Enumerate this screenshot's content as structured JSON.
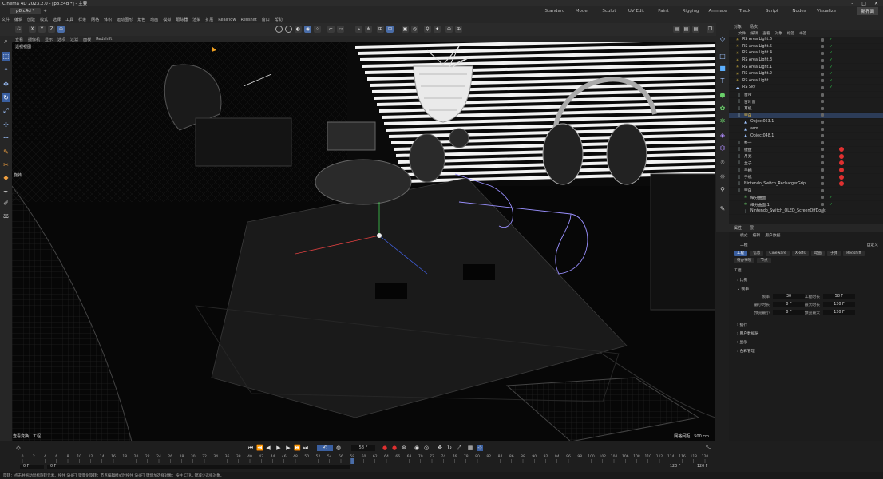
{
  "titlebar": {
    "title": "Cinema 4D 2023.2.0 - [p8.c4d *] - 主要"
  },
  "tabs": {
    "document": "p8.c4d *",
    "layouts": [
      "Standard",
      "Model",
      "Sculpt",
      "UV Edit",
      "Paint",
      "Rigging",
      "Animate",
      "Track",
      "Script",
      "Nodes",
      "Visualize"
    ],
    "new_label": "新界面"
  },
  "menubar": [
    "文件",
    "编辑",
    "创建",
    "模式",
    "选择",
    "工具",
    "样条",
    "网格",
    "体积",
    "运动图形",
    "角色",
    "动画",
    "模拟",
    "跟踪器",
    "渲染",
    "扩展",
    "RealFlow",
    "Redshift",
    "窗口",
    "帮助"
  ],
  "toolbar": {
    "x": "X",
    "y": "Y",
    "z": "Z"
  },
  "viewport_menu": [
    "查看",
    "摄像机",
    "显示",
    "选项",
    "过滤",
    "面板",
    "Redshift"
  ],
  "viewport": {
    "camera": "透视视图",
    "mode": "旋转",
    "selection_label": "查看变换：工程",
    "grid": "网格间距：500 cm"
  },
  "object_manager": {
    "tabs": [
      "对象",
      "场次"
    ],
    "menu": [
      "文件",
      "编辑",
      "查看",
      "对象",
      "标签",
      "书签"
    ],
    "rows": [
      {
        "name": "RS Area Light.6",
        "icon": "light"
      },
      {
        "name": "RS Area Light.5",
        "icon": "light"
      },
      {
        "name": "RS Area Light.4",
        "icon": "light"
      },
      {
        "name": "RS Area Light.3",
        "icon": "light"
      },
      {
        "name": "RS Area Light.1",
        "icon": "light"
      },
      {
        "name": "RS Area Light.2",
        "icon": "light"
      },
      {
        "name": "RS Area Light",
        "icon": "light"
      },
      {
        "name": "RS Sky",
        "icon": "sky"
      },
      {
        "name": "窗帘",
        "icon": "null"
      },
      {
        "name": "百叶窗",
        "icon": "null"
      },
      {
        "name": "耳机",
        "icon": "null"
      },
      {
        "name": "空白",
        "icon": "null",
        "selected": true
      },
      {
        "name": "Object053.1",
        "icon": "mesh"
      },
      {
        "name": "arm",
        "icon": "mesh"
      },
      {
        "name": "Object048.1",
        "icon": "mesh"
      },
      {
        "name": "杯子",
        "icon": "null"
      },
      {
        "name": "键盘",
        "icon": "null"
      },
      {
        "name": "月亮",
        "icon": "null"
      },
      {
        "name": "盒子",
        "icon": "null"
      },
      {
        "name": "手柄",
        "icon": "null"
      },
      {
        "name": "手机",
        "icon": "null"
      },
      {
        "name": "Nintendo_Switch_RechargerGrip",
        "icon": "null"
      },
      {
        "name": "空白",
        "icon": "null"
      },
      {
        "name": "细分曲面",
        "icon": "subd"
      },
      {
        "name": "细分曲面.1",
        "icon": "subd"
      },
      {
        "name": "Nintendo_Switch_OLED_ScreenOffDock",
        "icon": "null"
      }
    ]
  },
  "attributes": {
    "tabs": [
      "属性",
      "层"
    ],
    "menu": [
      "模式",
      "编辑",
      "用户数据"
    ],
    "preset": "自定义",
    "title": "工程",
    "subtabs": [
      "工程",
      "信息",
      "Cineware",
      "XRefs",
      "动画",
      "子弹",
      "Redshift"
    ],
    "subtabs2": [
      "待办事项",
      "节点"
    ],
    "section": "工程",
    "groups": [
      "比例",
      "帧率",
      "执行",
      "用户数据层",
      "显示",
      "色彩管理"
    ],
    "fields": {
      "fps_label": "帧率",
      "fps": "30",
      "project_time_label": "工程时长",
      "project_time": "58 F",
      "min_time_label": "最小时长",
      "min_time": "0 F",
      "max_time_label": "最大时长",
      "max_time": "120 F",
      "preview_min_label": "预览最小",
      "preview_min": "0 F",
      "preview_max_label": "预览最大",
      "preview_max": "120 F"
    }
  },
  "timeline": {
    "current_frame": "58 F",
    "start": "0 F",
    "start2": "0 F",
    "end": "120 F",
    "end2": "120 F",
    "ticks": [
      "0",
      "2",
      "4",
      "6",
      "8",
      "10",
      "12",
      "14",
      "16",
      "18",
      "20",
      "22",
      "24",
      "26",
      "28",
      "30",
      "32",
      "34",
      "36",
      "38",
      "40",
      "42",
      "44",
      "46",
      "48",
      "50",
      "52",
      "54",
      "56",
      "58",
      "60",
      "62",
      "64",
      "66",
      "68",
      "70",
      "72",
      "74",
      "76",
      "78",
      "80",
      "82",
      "84",
      "86",
      "88",
      "90",
      "92",
      "94",
      "96",
      "98",
      "100",
      "102",
      "104",
      "106",
      "108",
      "110",
      "112",
      "114",
      "116",
      "118",
      "120"
    ]
  },
  "status": "旋转：点击并拖动鼠标旋转元素。按住 SHIFT 键量化旋转；节点编辑模式时按住 SHIFT 键增加选择对象；按住 CTRL 键减少选择对象。",
  "colors": {
    "accent": "#4a6da8",
    "check": "#2ec84a",
    "tag_red": "#e03030",
    "spline": "#9a90ff"
  }
}
